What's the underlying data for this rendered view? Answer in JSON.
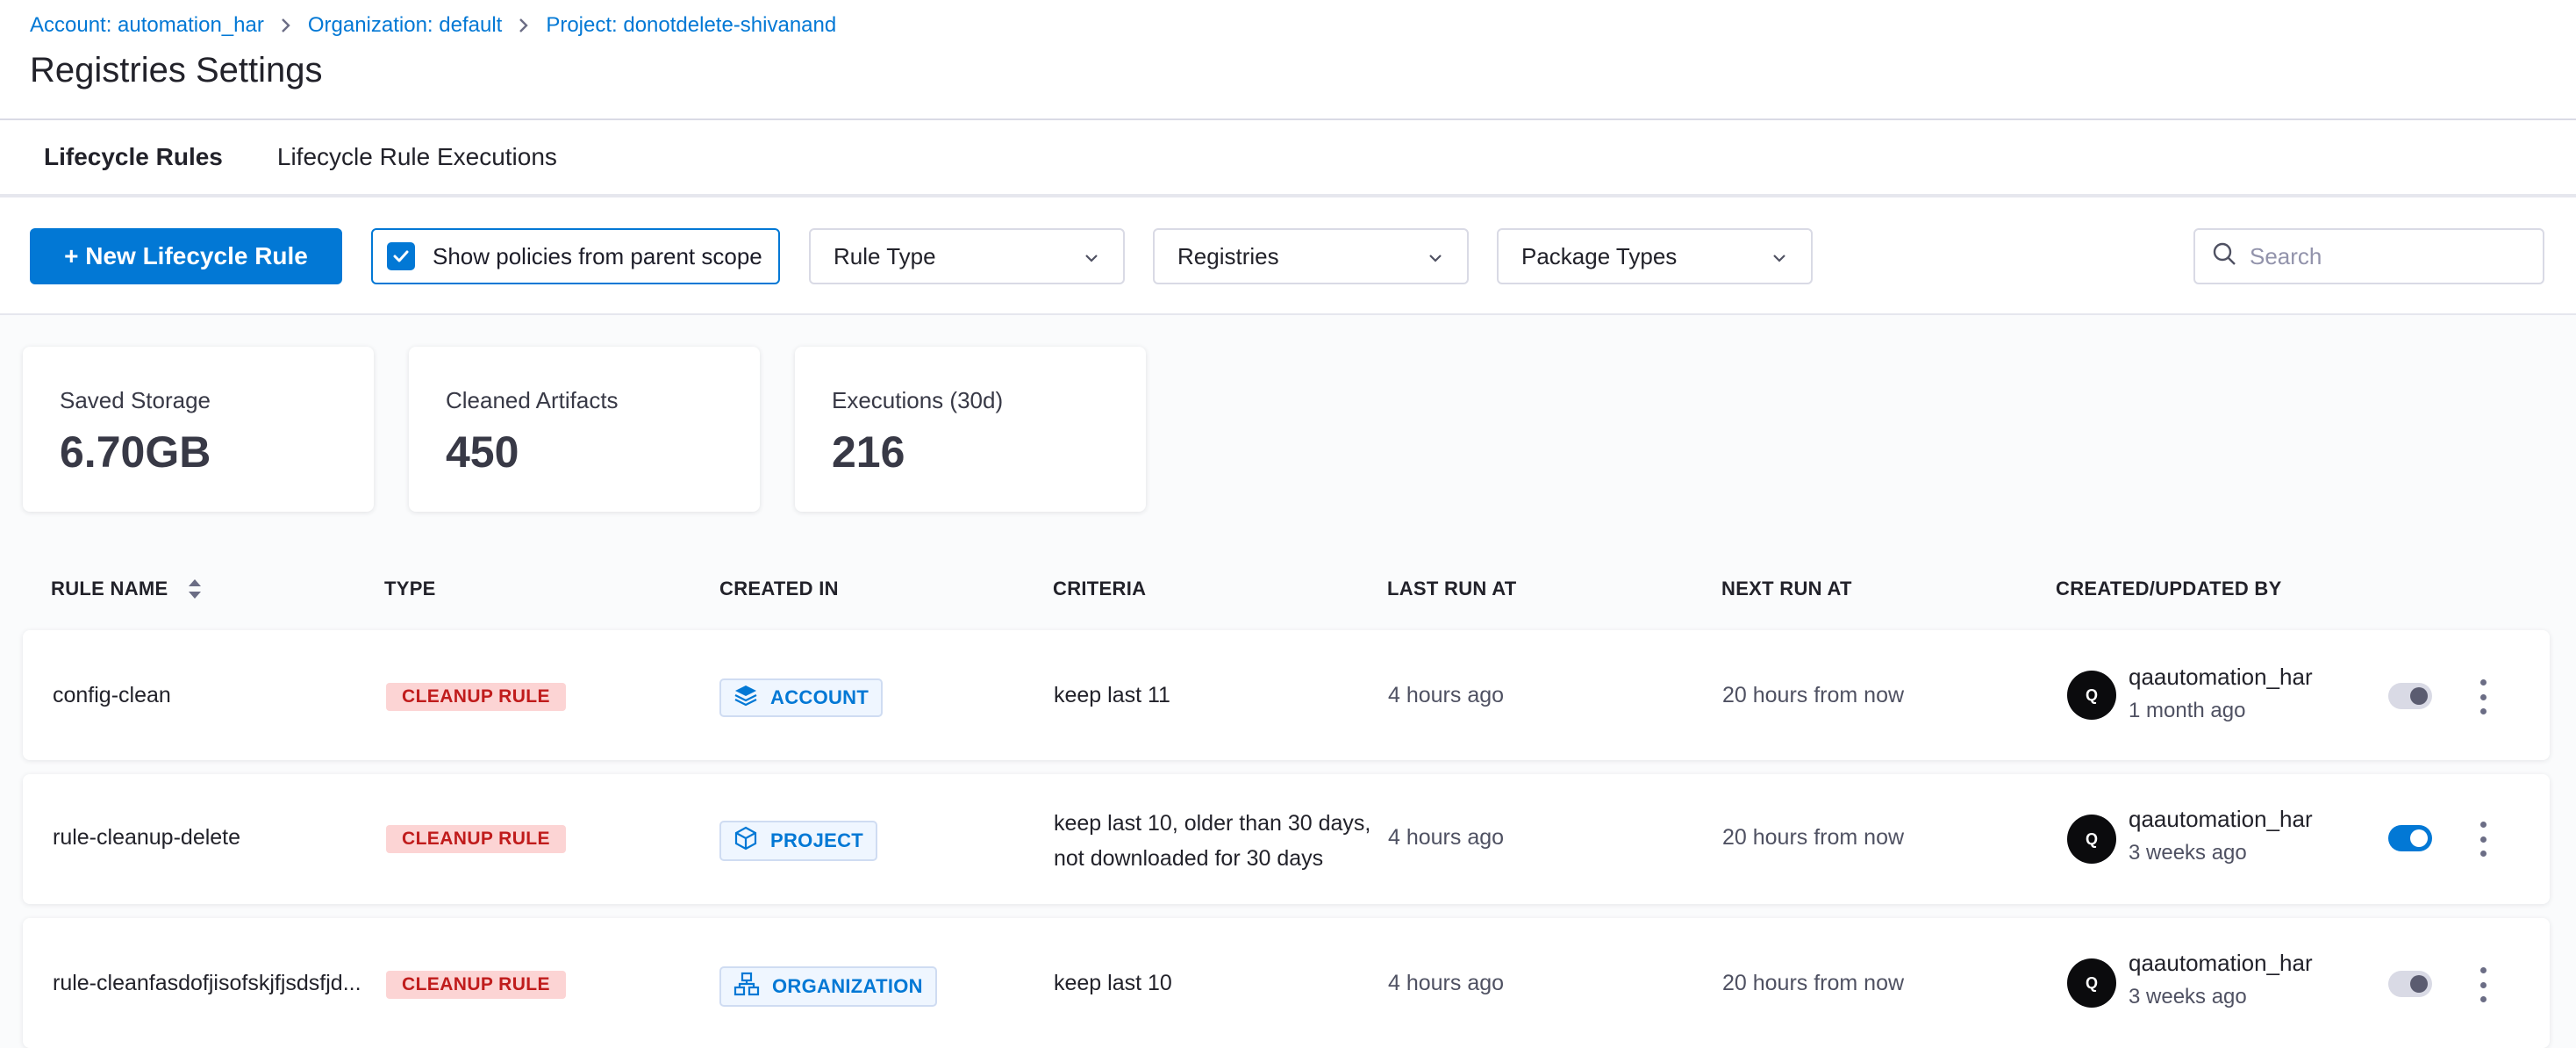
{
  "breadcrumb": [
    {
      "label": "Account: automation_har"
    },
    {
      "label": "Organization: default"
    },
    {
      "label": "Project: donotdelete-shivanand"
    }
  ],
  "page_title": "Registries Settings",
  "tabs": [
    {
      "label": "Lifecycle Rules",
      "active": true
    },
    {
      "label": "Lifecycle Rule Executions",
      "active": false
    }
  ],
  "toolbar": {
    "new_rule_label": "+ New Lifecycle Rule",
    "parent_scope_label": "Show policies from parent scope",
    "parent_scope_checked": true,
    "filters": [
      {
        "label": "Rule Type"
      },
      {
        "label": "Registries"
      },
      {
        "label": "Package Types"
      }
    ],
    "search_placeholder": "Search"
  },
  "stats": [
    {
      "label": "Saved Storage",
      "value": "6.70GB"
    },
    {
      "label": "Cleaned Artifacts",
      "value": "450"
    },
    {
      "label": "Executions (30d)",
      "value": "216"
    }
  ],
  "table": {
    "columns": [
      "RULE NAME",
      "TYPE",
      "CREATED IN",
      "CRITERIA",
      "LAST RUN AT",
      "NEXT RUN AT",
      "CREATED/UPDATED BY"
    ],
    "rows": [
      {
        "name": "config-clean",
        "type": "CLEANUP RULE",
        "scope": "ACCOUNT",
        "criteria_line1": "keep last 11",
        "criteria_line2": "",
        "last_run": "4 hours ago",
        "next_run": "20 hours from now",
        "avatar": "Q",
        "user": "qaautomation_har",
        "updated": "1 month ago",
        "enabled": false
      },
      {
        "name": "rule-cleanup-delete",
        "type": "CLEANUP RULE",
        "scope": "PROJECT",
        "criteria_line1": "keep last 10, older than 30 days,",
        "criteria_line2": "not downloaded for 30 days",
        "last_run": "4 hours ago",
        "next_run": "20 hours from now",
        "avatar": "Q",
        "user": "qaautomation_har",
        "updated": "3 weeks ago",
        "enabled": true
      },
      {
        "name": "rule-cleanfasdofjisofskjfjsdsfjd...",
        "type": "CLEANUP RULE",
        "scope": "ORGANIZATION",
        "criteria_line1": "keep last 10",
        "criteria_line2": "",
        "last_run": "4 hours ago",
        "next_run": "20 hours from now",
        "avatar": "Q",
        "user": "qaautomation_har",
        "updated": "3 weeks ago",
        "enabled": false
      }
    ]
  },
  "colors": {
    "accent": "#0278d5",
    "cleanup_bg": "#fcd4d4",
    "cleanup_fg": "#c01c1c"
  }
}
